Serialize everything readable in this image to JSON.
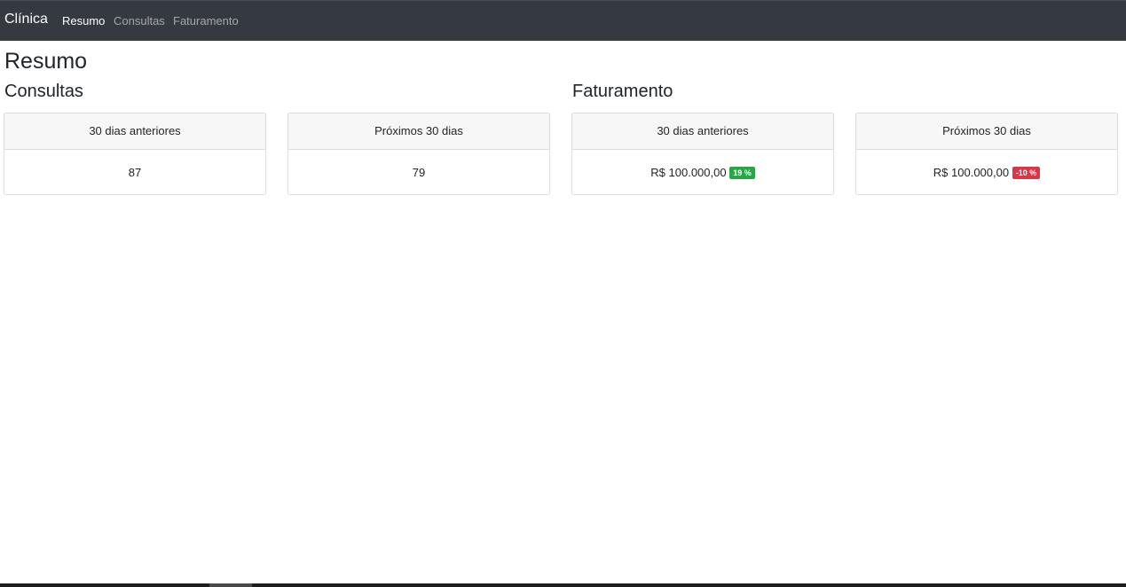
{
  "navbar": {
    "brand": "Clínica",
    "links": [
      "Resumo",
      "Consultas",
      "Faturamento"
    ],
    "active": "Resumo"
  },
  "page": {
    "title": "Resumo"
  },
  "consultas": {
    "title": "Consultas",
    "cards": [
      {
        "header": "30 dias anteriores",
        "value": "87"
      },
      {
        "header": "Próximos 30 dias",
        "value": "79"
      }
    ]
  },
  "faturamento": {
    "title": "Faturamento",
    "cards": [
      {
        "header": "30 dias anteriores",
        "value": "R$ 100.000,00",
        "badge": "19 %",
        "badge_status": "success"
      },
      {
        "header": "Próximos 30 dias",
        "value": "R$ 100.000,00",
        "badge": "-10 %",
        "badge_status": "danger"
      }
    ]
  },
  "colors": {
    "navbar_bg": "#343a40",
    "success": "#28a745",
    "danger": "#dc3545"
  }
}
